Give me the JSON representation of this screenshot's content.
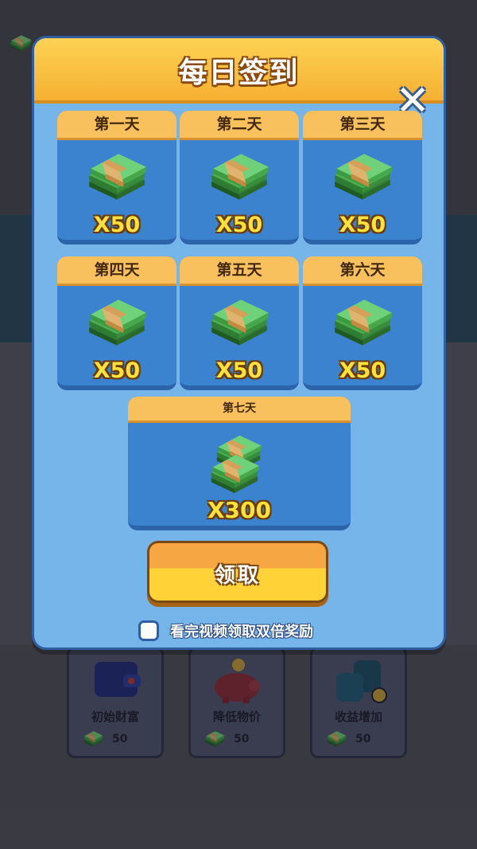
{
  "dialog": {
    "title": "每日签到",
    "close_glyph": "✕",
    "days": [
      {
        "label": "第一天",
        "amount": "X50",
        "icon": "cash-stack-icon"
      },
      {
        "label": "第二天",
        "amount": "X50",
        "icon": "cash-stack-icon"
      },
      {
        "label": "第三天",
        "amount": "X50",
        "icon": "cash-stack-icon"
      },
      {
        "label": "第四天",
        "amount": "X50",
        "icon": "cash-stack-icon"
      },
      {
        "label": "第五天",
        "amount": "X50",
        "icon": "cash-stack-icon"
      },
      {
        "label": "第六天",
        "amount": "X50",
        "icon": "cash-stack-icon"
      },
      {
        "label": "第七天",
        "amount": "X300",
        "icon": "cash-pile-icon"
      }
    ],
    "claim_label": "领取",
    "double_reward_label": "看完视频领取双倍奖励",
    "double_reward_checked": false
  },
  "background_shop": {
    "items": [
      {
        "name": "初始财富",
        "cost": "50",
        "icon": "wallet-icon"
      },
      {
        "name": "降低物价",
        "cost": "50",
        "icon": "piggy-bank-icon"
      },
      {
        "name": "收益增加",
        "cost": "50",
        "icon": "coin-stack-icon"
      }
    ]
  },
  "colors": {
    "panel": "#75b5ea",
    "header": "#f6b032",
    "card": "#3b82cf",
    "card_header": "#f8c15d",
    "amount_text": "#fde23a",
    "claim_button": "#ffd238"
  }
}
